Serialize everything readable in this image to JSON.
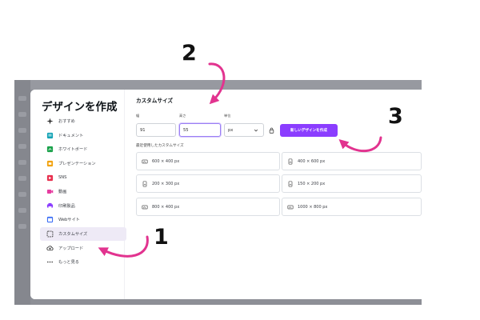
{
  "annotations": {
    "step_1": "1",
    "step_2": "2",
    "step_3": "3",
    "arrow_color": "#e2338f"
  },
  "modal": {
    "title": "デザインを作成"
  },
  "sidebar": {
    "items": [
      {
        "icon": "sparkle-icon",
        "label": "おすすめ",
        "color": "#333333"
      },
      {
        "icon": "document-icon",
        "label": "ドキュメント",
        "color": "#13a3b5"
      },
      {
        "icon": "whiteboard-icon",
        "label": "ホワイトボード",
        "color": "#1ba24b"
      },
      {
        "icon": "presentation-icon",
        "label": "プレゼンテーション",
        "color": "#f2a20c"
      },
      {
        "icon": "sns-icon",
        "label": "SNS",
        "color": "#e8314f"
      },
      {
        "icon": "video-icon",
        "label": "動画",
        "color": "#e63ca0"
      },
      {
        "icon": "print-icon",
        "label": "印刷製品",
        "color": "#8b3dff"
      },
      {
        "icon": "website-icon",
        "label": "Webサイト",
        "color": "#3b6ef5"
      },
      {
        "icon": "custom-size-icon",
        "label": "カスタムサイズ",
        "color": "#333333",
        "active": true
      },
      {
        "icon": "upload-icon",
        "label": "アップロード",
        "color": "#333333"
      },
      {
        "icon": "more-icon",
        "label": "もっと見る",
        "color": "#333333"
      }
    ]
  },
  "main": {
    "title": "カスタムサイズ",
    "width_label": "幅",
    "height_label": "高さ",
    "unit_label": "単位",
    "width_value": "91",
    "height_value": "55",
    "unit_value": "px",
    "create_button": "新しいデザインを作成",
    "recent_label": "最近使用したカスタムサイズ",
    "recent_sizes": [
      {
        "label": "600 × 400 px",
        "orientation": "landscape"
      },
      {
        "label": "400 × 600 px",
        "orientation": "portrait"
      },
      {
        "label": "200 × 300 px",
        "orientation": "portrait"
      },
      {
        "label": "150 × 200 px",
        "orientation": "portrait"
      },
      {
        "label": "800 × 400 px",
        "orientation": "landscape"
      },
      {
        "label": "1000 × 800 px",
        "orientation": "landscape"
      }
    ]
  },
  "colors": {
    "accent": "#8b3dff",
    "active_nav_bg": "#eeeaf6",
    "overlay": "#8d8f96"
  }
}
